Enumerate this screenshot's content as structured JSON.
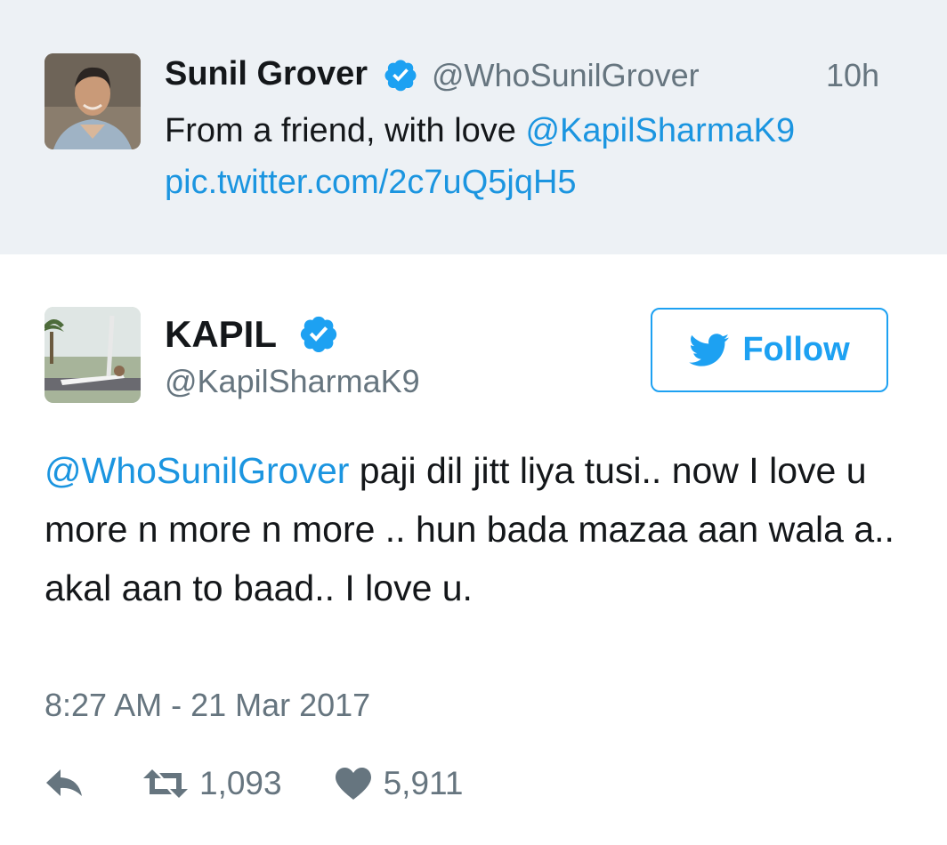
{
  "quoted_tweet": {
    "display_name": "Sunil Grover",
    "handle": "@WhoSunilGrover",
    "time_ago": "10h",
    "text_plain": "From a friend, with love ",
    "mention": "@KapilSharmaK9",
    "media_link": "pic.twitter.com/2c7uQ5jqH5"
  },
  "tweet": {
    "display_name": "KAPIL",
    "handle": "@KapilSharmaK9",
    "follow_label": "Follow",
    "mention": "@WhoSunilGrover",
    "text": " paji dil jitt liya tusi.. now I love u more n more n more .. hun bada mazaa aan wala a.. akal aan to baad.. I love u.",
    "timestamp": "8:27 AM - 21 Mar 2017",
    "retweet_count": "1,093",
    "like_count": "5,911"
  },
  "icons": {
    "verified": "verified-badge-icon",
    "follow": "twitter-bird-icon",
    "reply": "reply-icon",
    "retweet": "retweet-icon",
    "like": "heart-icon"
  },
  "colors": {
    "link": "#1b95e0",
    "brand": "#1da1f2",
    "muted": "#66757f",
    "quoted_bg": "#edf1f5"
  }
}
